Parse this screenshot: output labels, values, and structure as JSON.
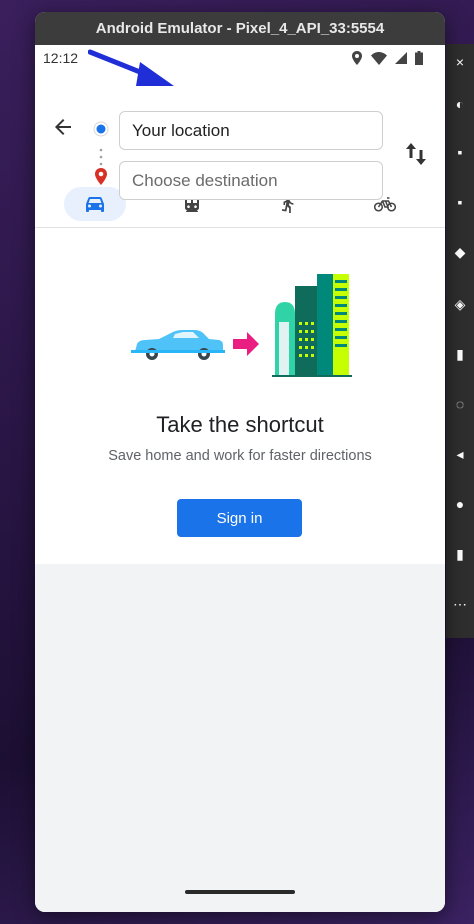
{
  "window": {
    "title": "Android Emulator - Pixel_4_API_33:5554"
  },
  "statusbar": {
    "time": "12:12"
  },
  "route": {
    "origin_value": "Your location",
    "destination_placeholder": "Choose destination"
  },
  "modes": [
    {
      "name": "drive",
      "icon": "car-icon",
      "active": true
    },
    {
      "name": "transit",
      "icon": "train-icon",
      "active": false
    },
    {
      "name": "walk",
      "icon": "walk-icon",
      "active": false
    },
    {
      "name": "bike",
      "icon": "bike-icon",
      "active": false
    }
  ],
  "promo": {
    "headline": "Take the shortcut",
    "subtext": "Save home and work for faster directions",
    "signin_label": "Sign in"
  },
  "colors": {
    "accent": "#1a73e8",
    "annotation_arrow": "#1f2ed6",
    "pin": "#d93025",
    "car": "#4fc3f7",
    "arrow_pink": "#e91e80",
    "building_green": "#2fd3a6"
  },
  "side_toolbar": {
    "close_label": "×"
  }
}
